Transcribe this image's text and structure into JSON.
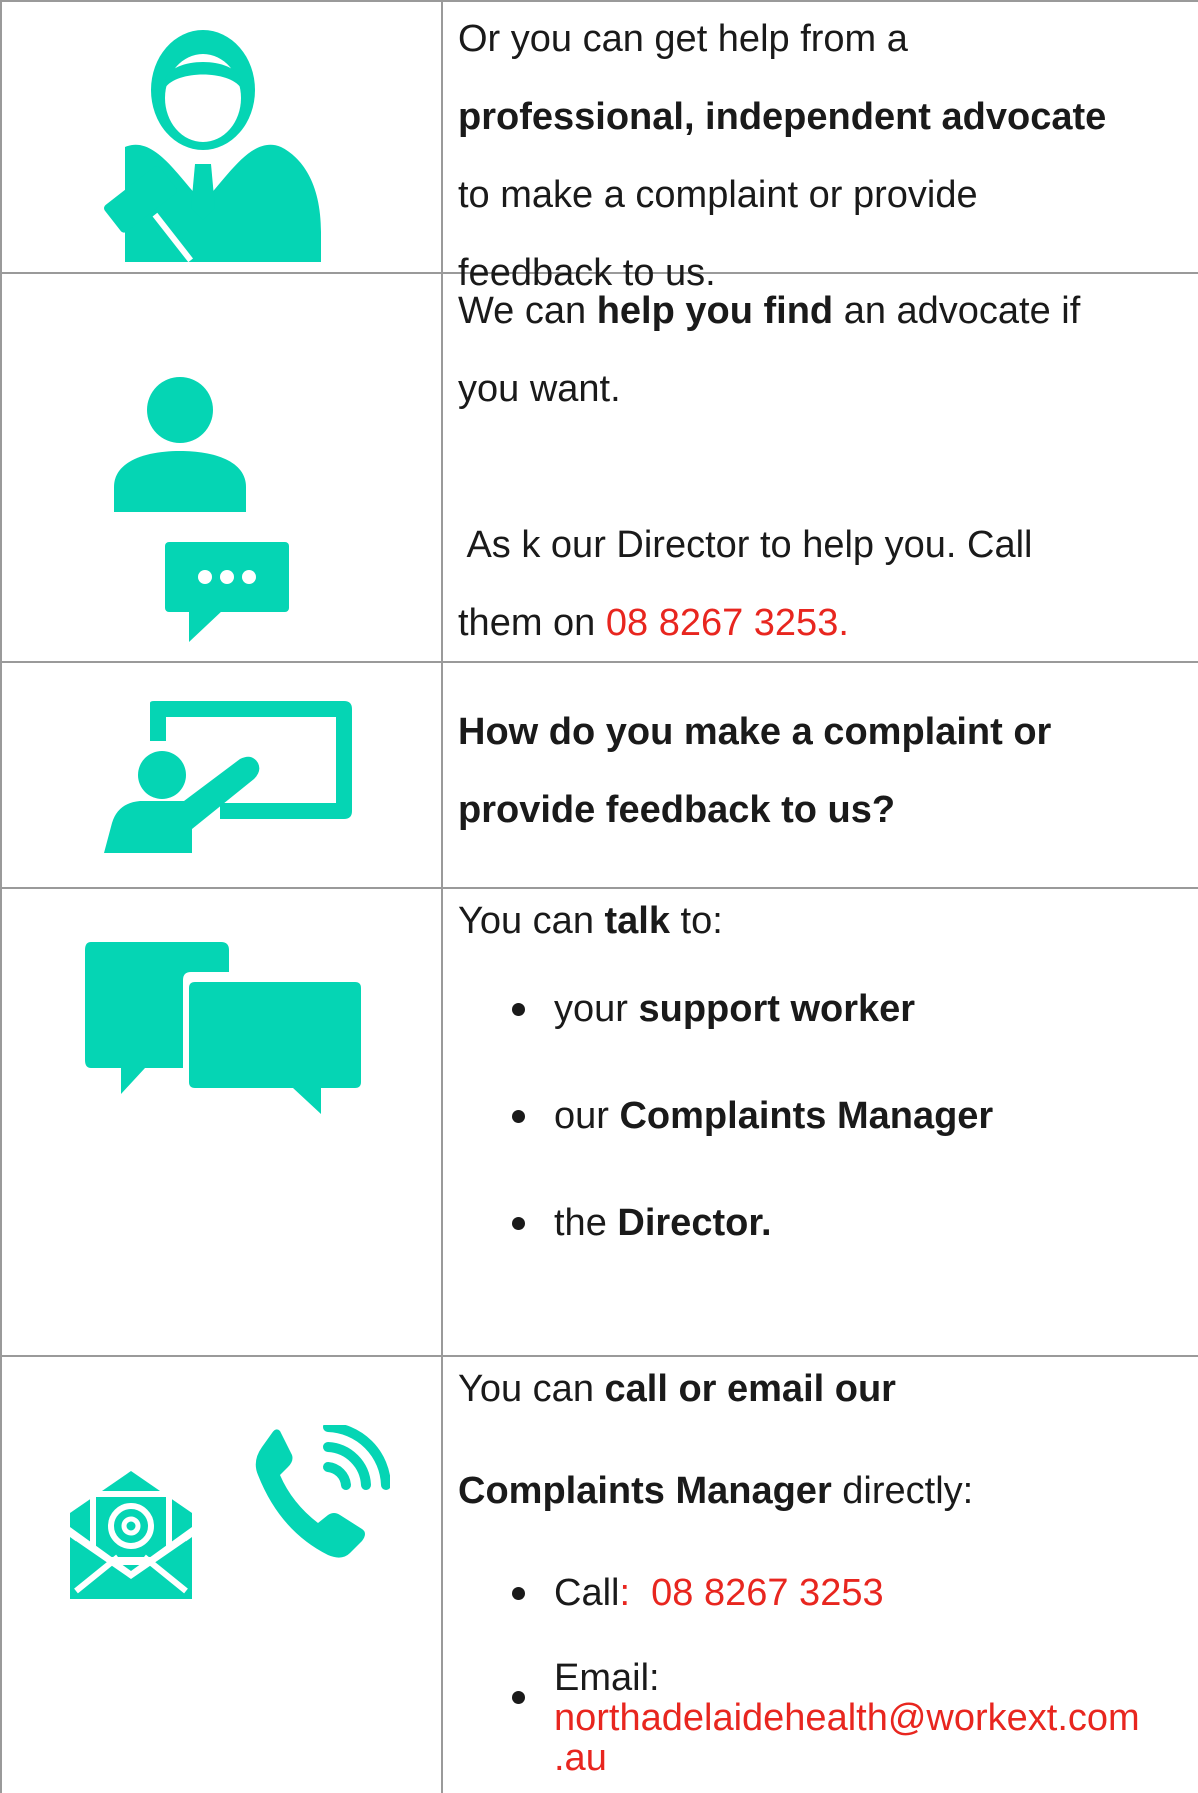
{
  "colors": {
    "icon_teal": "#05D5B4",
    "link_red": "#E8261F",
    "border": "#9A9A9A",
    "text": "#1A1A1A"
  },
  "rows": [
    {
      "icon": "advocate-gavel-icon",
      "lines": {
        "l1": "Or you can get help from a",
        "l2_bold": "professional, independent advocate",
        "l3": "to make a complaint or provide",
        "l4": "feedback to us."
      }
    },
    {
      "icon": "person-speech-bubble-icon",
      "lines": {
        "l1_pre": "We can ",
        "l1_bold": "help you find",
        "l1_post": " an advocate if",
        "l2": "you want.",
        "l3": " As k our Director to help you. Call",
        "l4_pre": "them on ",
        "l4_red": "08 8267 3253."
      }
    },
    {
      "icon": "presentation-board-icon",
      "lines": {
        "l1_bold": "How do you make a complaint or",
        "l2_bold": "provide feedback to us?"
      }
    },
    {
      "icon": "chat-bubbles-icon",
      "lines": {
        "l1_pre": "You can ",
        "l1_bold": "talk",
        "l1_post": " to:",
        "bullets": [
          {
            "pre": "your ",
            "bold": "support worker"
          },
          {
            "pre": "our ",
            "bold": "Complaints Manager"
          },
          {
            "pre": "the ",
            "bold": "Director."
          }
        ]
      }
    },
    {
      "icon": "email-phone-icon",
      "lines": {
        "l1_pre": "You can ",
        "l1_bold": "call or email our",
        "l2_bold": "Complaints Manager",
        "l2_post": " directly:",
        "call_label": "Call",
        "call_number": ":  08 8267 3253",
        "email_label": "Email:",
        "email_line1": "northadelaidehealth@workext.com",
        "email_line2": ".au"
      }
    }
  ]
}
